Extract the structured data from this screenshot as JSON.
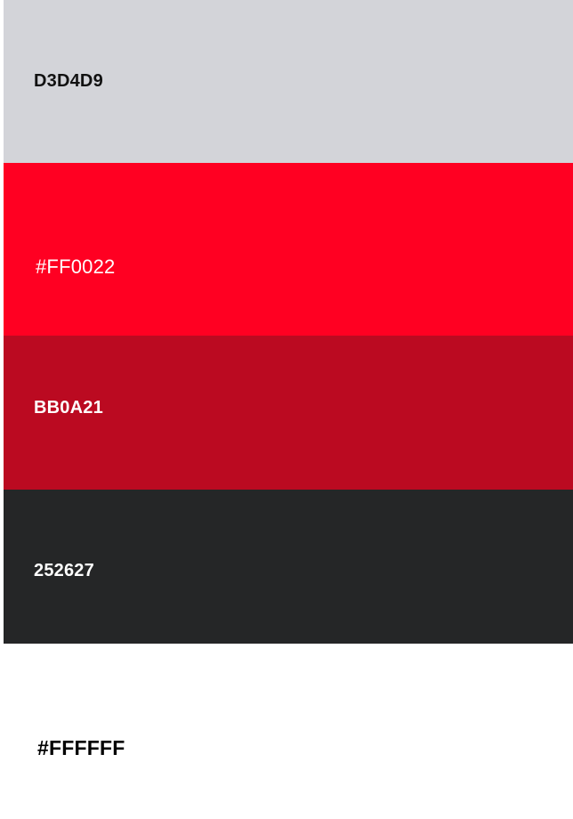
{
  "swatches": [
    {
      "label": "D3D4D9",
      "color": "#D3D4D9",
      "text_color": "#111111"
    },
    {
      "label": "#FF0022",
      "color": "#FF0022",
      "text_color": "#FFFFFF"
    },
    {
      "label": "BB0A21",
      "color": "#BB0A21",
      "text_color": "#FFFFFF"
    },
    {
      "label": "252627",
      "color": "#252627",
      "text_color": "#FFFFFF"
    },
    {
      "label": "#FFFFFF",
      "color": "#FFFFFF",
      "text_color": "#000000"
    }
  ]
}
